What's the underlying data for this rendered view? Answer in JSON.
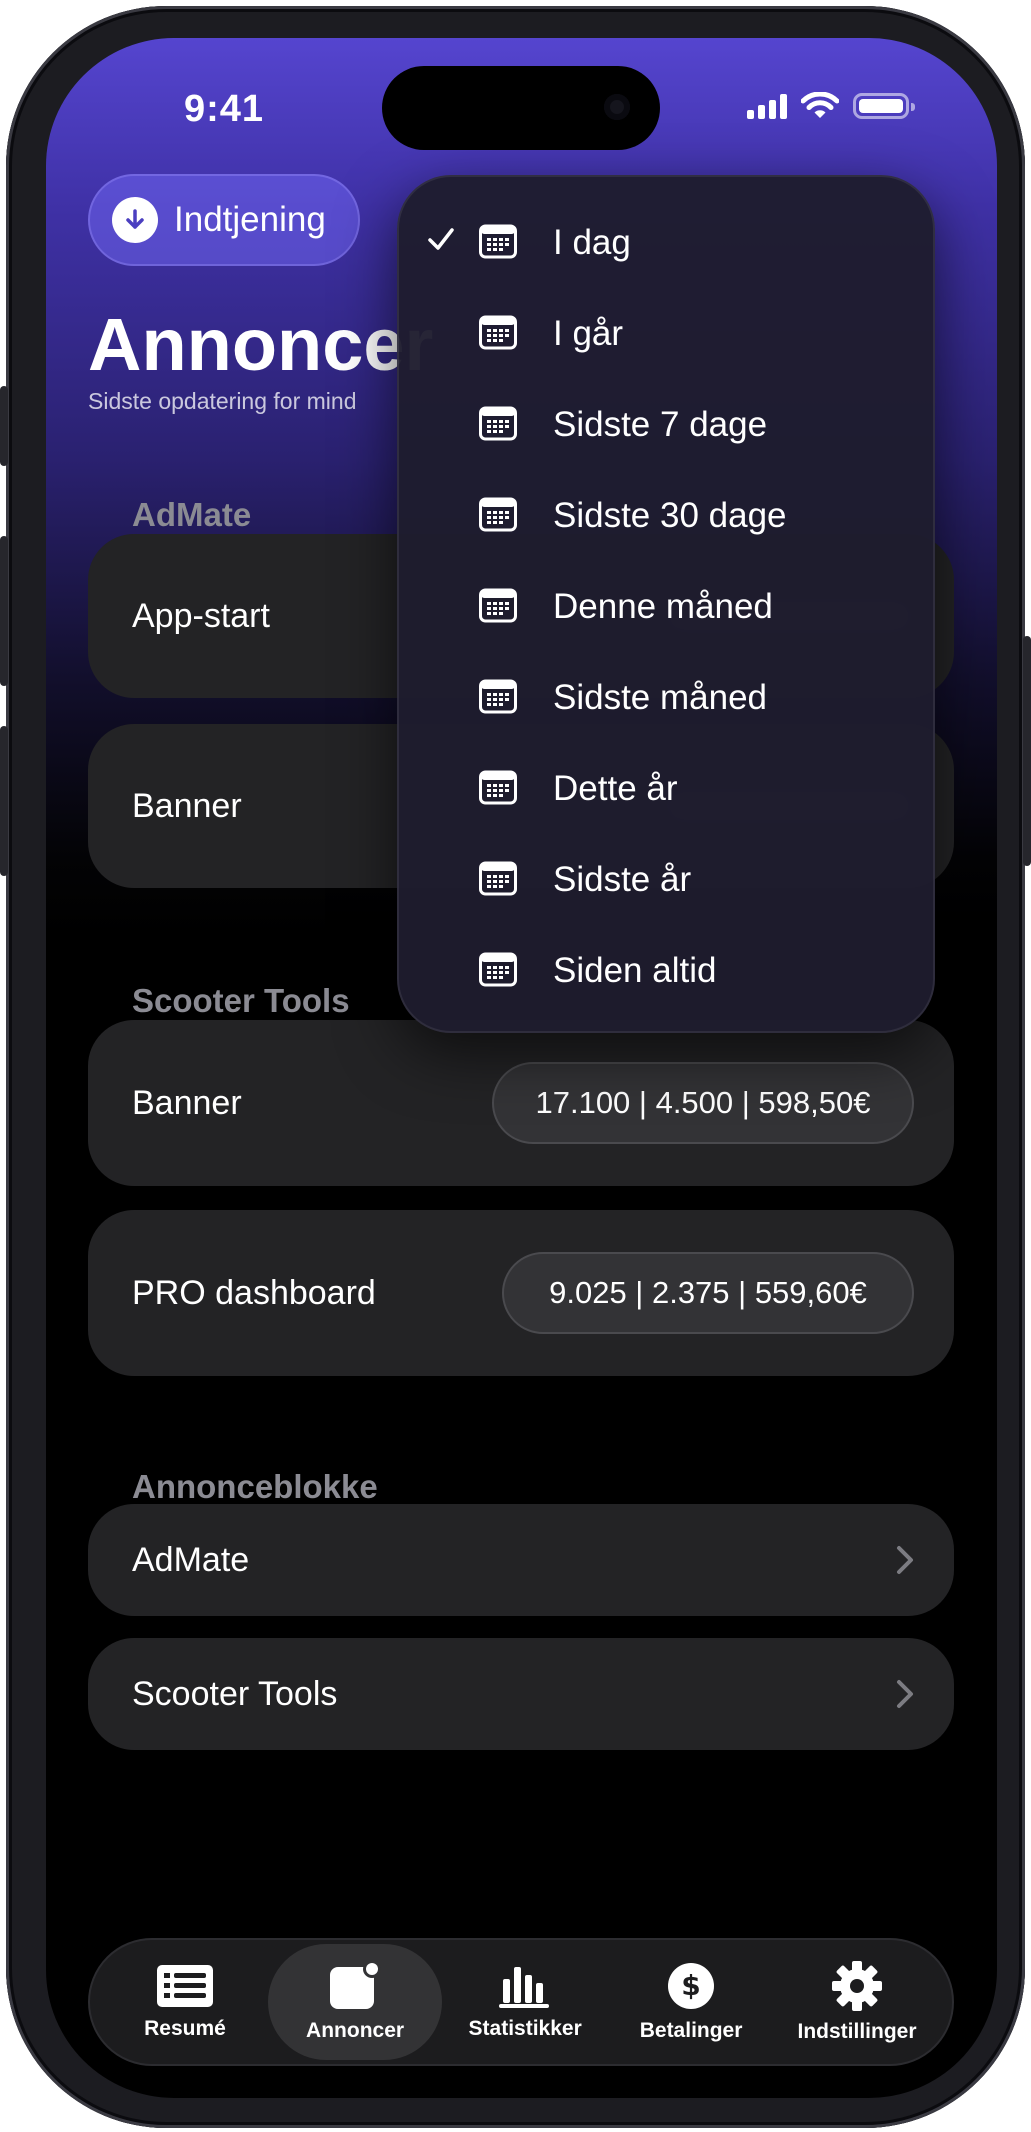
{
  "status_bar": {
    "time": "9:41"
  },
  "header": {
    "earnings_button_label": "Indtjening",
    "title": "Annoncer",
    "subtitle": "Sidste opdatering for mind"
  },
  "sections": [
    {
      "title": "AdMate",
      "cards": [
        {
          "label": "App-start"
        },
        {
          "label": "Banner"
        }
      ]
    },
    {
      "title": "Scooter Tools",
      "cards": [
        {
          "label": "Banner",
          "stats": "17.100 | 4.500 | 598,50€"
        },
        {
          "label": "PRO dashboard",
          "stats": "9.025 | 2.375 | 559,60€"
        }
      ]
    },
    {
      "title": "Annonceblokke",
      "links": [
        {
          "label": "AdMate"
        },
        {
          "label": "Scooter Tools"
        }
      ]
    }
  ],
  "date_menu": {
    "selected_index": 0,
    "items": [
      {
        "label": "I dag"
      },
      {
        "label": "I går"
      },
      {
        "label": "Sidste 7 dage"
      },
      {
        "label": "Sidste 30 dage"
      },
      {
        "label": "Denne måned"
      },
      {
        "label": "Sidste måned"
      },
      {
        "label": "Dette år"
      },
      {
        "label": "Sidste år"
      },
      {
        "label": "Siden altid"
      }
    ]
  },
  "tab_bar": {
    "active_index": 1,
    "tabs": [
      {
        "label": "Resumé",
        "icon": "list-icon"
      },
      {
        "label": "Annoncer",
        "icon": "ad-icon"
      },
      {
        "label": "Statistikker",
        "icon": "chart-bars-icon"
      },
      {
        "label": "Betalinger",
        "icon": "dollar-icon"
      },
      {
        "label": "Indstillinger",
        "icon": "gear-icon"
      }
    ]
  },
  "colors": {
    "accent_purple": "#5545cf",
    "card_bg": "#232325",
    "section_title": "#8b8b93"
  }
}
